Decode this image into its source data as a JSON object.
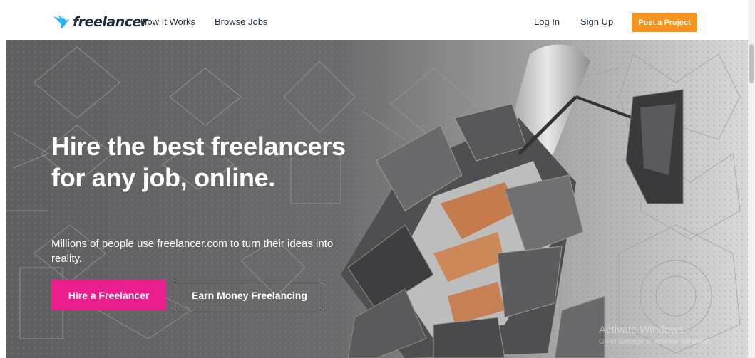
{
  "nav": {
    "logo_text": "freelancer",
    "how_it_works": "How It Works",
    "browse_jobs": "Browse Jobs",
    "log_in": "Log In",
    "sign_up": "Sign Up",
    "post_project": "Post a Project"
  },
  "hero": {
    "headline": "Hire the best freelancers for any job, online.",
    "subline": "Millions of people use freelancer.com to turn their ideas into reality.",
    "hire_button": "Hire a Freelancer",
    "earn_button": "Earn Money Freelancing"
  },
  "watermark": {
    "title": "Activate Windows",
    "subtitle": "Go to Settings to activate Windows."
  },
  "colors": {
    "accent_orange": "#f7931e",
    "accent_pink": "#e91e8c",
    "logo_blue": "#29b2fe",
    "hero_gray": "#6e6e70"
  }
}
